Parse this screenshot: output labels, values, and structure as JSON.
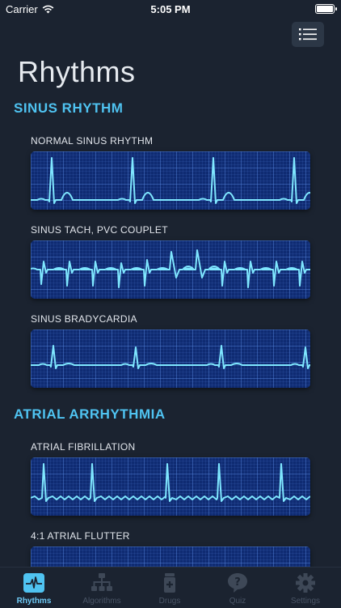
{
  "status_bar": {
    "carrier": "Carrier",
    "time": "5:05 PM",
    "battery_level": 1.0
  },
  "header": {
    "title": "Rhythms",
    "menu_icon": "list-icon"
  },
  "sections": [
    {
      "title": "SINUS RHYTHM",
      "items": [
        {
          "label": "NORMAL SINUS RHYTHM"
        },
        {
          "label": "SINUS TACH, PVC COUPLET"
        },
        {
          "label": "SINUS BRADYCARDIA"
        }
      ]
    },
    {
      "title": "ATRIAL ARRHYTHMIA",
      "items": [
        {
          "label": "ATRIAL FIBRILLATION"
        },
        {
          "label": "4:1 ATRIAL FLUTTER"
        }
      ]
    }
  ],
  "tabs": [
    {
      "label": "Rhythms",
      "icon": "ecg-icon",
      "active": true
    },
    {
      "label": "Algorithms",
      "icon": "flowchart-icon",
      "active": false
    },
    {
      "label": "Drugs",
      "icon": "pill-bottle-icon",
      "active": false
    },
    {
      "label": "Quiz",
      "icon": "question-bubble-icon",
      "active": false
    },
    {
      "label": "Settings",
      "icon": "gear-icon",
      "active": false
    }
  ],
  "colors": {
    "accent": "#4fc3f1",
    "background": "#1b2330",
    "trace": "#7fe7ff",
    "strip": "#0f2b72"
  }
}
